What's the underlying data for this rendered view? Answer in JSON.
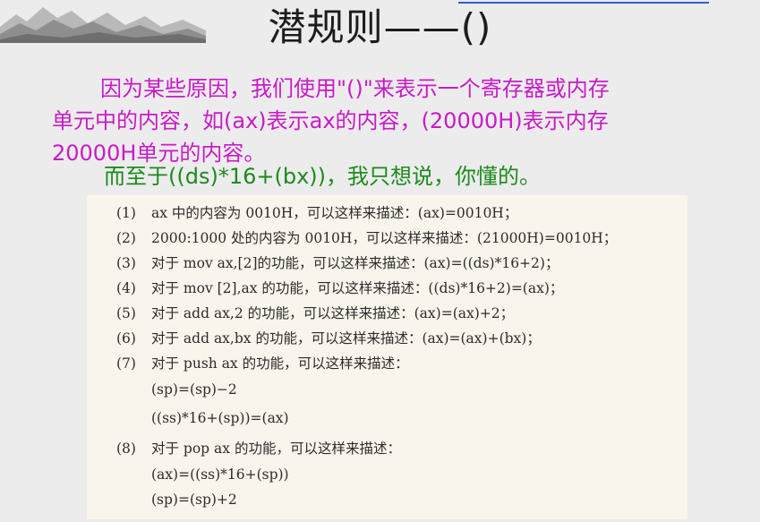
{
  "title": "潜规则——()",
  "paragraph": {
    "line1": "因为某些原因，我们使用\"()\"来表示一个寄存器或内存",
    "line2": "单元中的内容，如(ax)表示ax的内容，(20000H)表示内存",
    "line3": "20000H单元的内容。"
  },
  "note": "而至于((ds)*16+(bx))，我只想说，你懂的。",
  "colors": {
    "magenta": "#c81ac8",
    "green": "#1e8a1e",
    "paper": "#faf5ec",
    "topline": "#2d5fd3"
  },
  "items": [
    {
      "num": "(1)",
      "text": "ax 中的内容为 0010H，可以这样来描述：(ax)=0010H；"
    },
    {
      "num": "(2)",
      "text": "2000:1000 处的内容为 0010H，可以这样来描述：(21000H)=0010H；"
    },
    {
      "num": "(3)",
      "text": "对于 mov ax,[2]的功能，可以这样来描述：(ax)=((ds)*16+2)；"
    },
    {
      "num": "(4)",
      "text": "对于 mov [2],ax 的功能，可以这样来描述：((ds)*16+2)=(ax)；"
    },
    {
      "num": "(5)",
      "text": "对于 add ax,2 的功能，可以这样来描述：(ax)=(ax)+2；"
    },
    {
      "num": "(6)",
      "text": "对于 add ax,bx 的功能，可以这样来描述：(ax)=(ax)+(bx)；"
    },
    {
      "num": "(7)",
      "text": "对于 push ax 的功能，可以这样来描述："
    },
    {
      "num": "",
      "text": "(sp)=(sp)−2"
    },
    {
      "num": "",
      "text": "((ss)*16+(sp))=(ax)"
    },
    {
      "num": "(8)",
      "text": "对于 pop ax 的功能，可以这样来描述："
    },
    {
      "num": "",
      "text": "(ax)=((ss)*16+(sp))"
    },
    {
      "num": "",
      "text": "(sp)=(sp)+2"
    }
  ]
}
